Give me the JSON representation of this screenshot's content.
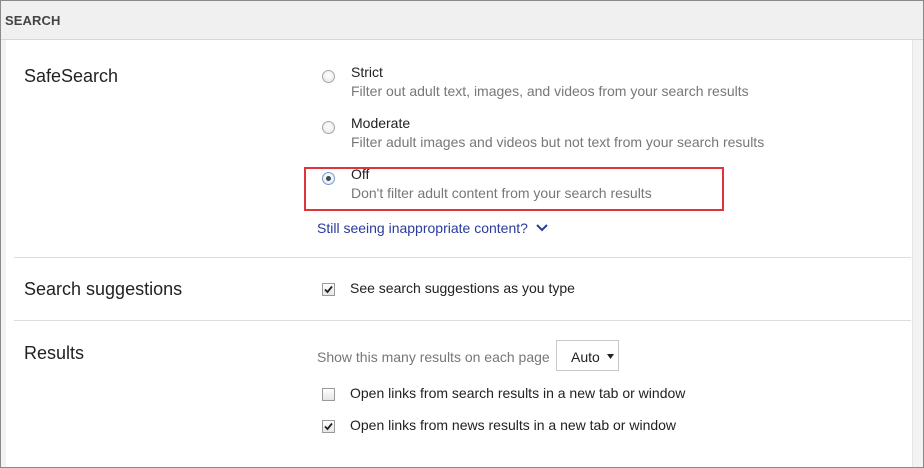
{
  "header": {
    "title": "SEARCH"
  },
  "safesearch": {
    "label": "SafeSearch",
    "options": [
      {
        "title": "Strict",
        "description": "Filter out adult text, images, and videos from your search results",
        "checked": false
      },
      {
        "title": "Moderate",
        "description": "Filter adult images and videos but not text from your search results",
        "checked": false
      },
      {
        "title": "Off",
        "description": "Don't filter adult content from your search results",
        "checked": true
      }
    ],
    "help_link": "Still seeing inappropriate content?",
    "help_link_icon": "chevron-down-icon"
  },
  "suggestions": {
    "label": "Search suggestions",
    "checkbox_label": "See search suggestions as you type",
    "checked": true
  },
  "results": {
    "label": "Results",
    "per_page_label": "Show this many results on each page",
    "per_page_value": "Auto",
    "open_search_links_label": "Open links from search results in a new tab or window",
    "open_search_links_checked": false,
    "open_news_links_label": "Open links from news results in a new tab or window",
    "open_news_links_checked": true
  },
  "colors": {
    "highlight_border": "#e0343b",
    "link": "#2a3b9c"
  }
}
